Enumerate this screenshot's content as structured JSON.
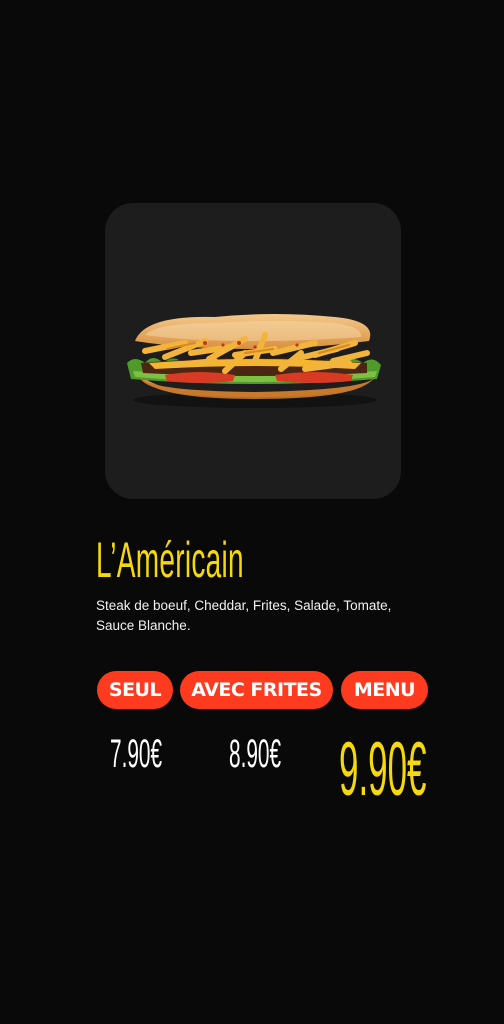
{
  "product": {
    "name": "L’Américain",
    "description": "Steak de boeuf, Cheddar, Frites, Salade, Tomate, Sauce Blanche.",
    "image": "sandwich-photo"
  },
  "options": [
    {
      "label": "SEUL",
      "price": "7.90€"
    },
    {
      "label": "AVEC FRITES",
      "price": "8.90€"
    },
    {
      "label": "MENU",
      "price": "9.90€"
    }
  ],
  "colors": {
    "background": "#090909",
    "card": "#1d1d1d",
    "accent_yellow": "#f5d90a",
    "pill_red": "#ff3b1f",
    "text": "#f2f2f2"
  }
}
